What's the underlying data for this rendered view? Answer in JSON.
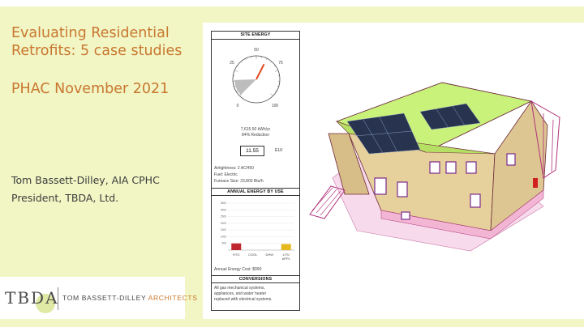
{
  "slide": {
    "title": "Evaluating Residential Retrofits: 5 case studies",
    "subtitle": "PHAC November 2021",
    "author_line1": "Tom Bassett-Dilley, AIA CPHC",
    "author_line2": "President, TBDA, Ltd."
  },
  "logo": {
    "mark": "TBDA",
    "name_part1": "TOM BASSETT-DILLEY",
    "name_part2": "ARCHITECTS"
  },
  "panel": {
    "site_energy_header": "SITE ENERGY",
    "gauge_ticks": [
      "0",
      "25",
      "50",
      "75",
      "100"
    ],
    "energy_value": "7,615.50 kWh/yr",
    "reduction": "84% Reduction",
    "eui_value": "11.55",
    "eui_label": "EUI",
    "airtightness": "Airtightness: 2 ACH50",
    "fuel": "Fuel: Electric",
    "furnace": "Furnace Size: 23,800 Btu/h",
    "annual_header": "ANNUAL ENERGY BY USE",
    "annual_cost": "Annual Energy Cost: $990",
    "conversions_header": "CONVERSIONS",
    "conversions_text_1": "All gas mechanical systems,",
    "conversions_text_2": "appliances, and water heater",
    "conversions_text_3": "replaced with electrical systems."
  },
  "chart_data": {
    "type": "bar",
    "categories": [
      "HTG",
      "COOL",
      "DHW",
      "LTS/APPL"
    ],
    "values": [
      500,
      0,
      0,
      450
    ],
    "colors": [
      "#c0262d",
      "#c0262d",
      "#c0262d",
      "#e5b81e"
    ],
    "ytick_labels": [
      "3500",
      "3000",
      "2500",
      "2000",
      "1500",
      "1000",
      "500"
    ],
    "ylim": [
      0,
      3500
    ]
  },
  "gauge_data": {
    "value_percent": 16,
    "reduction_percent": 84,
    "needle_color": "#e04a1c",
    "wedge_color": "#bdbdbd"
  }
}
